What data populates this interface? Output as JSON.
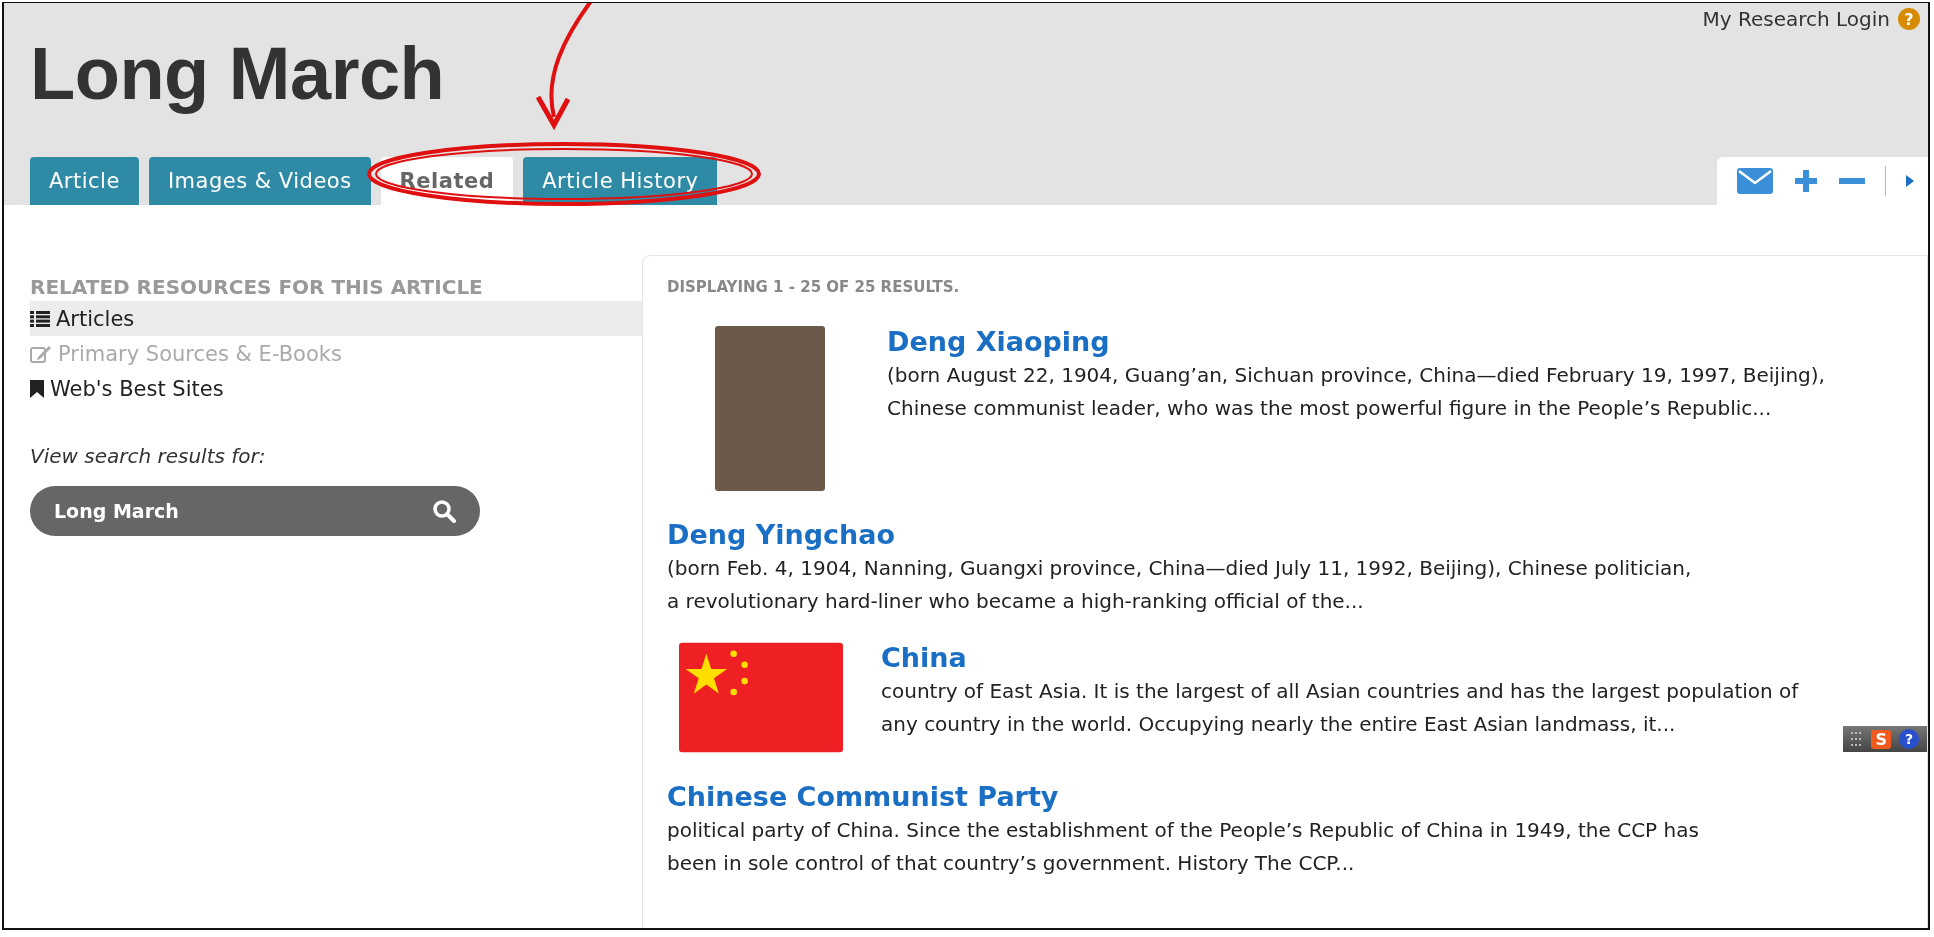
{
  "header": {
    "login_link": "My Research Login",
    "help_icon": "?",
    "title": "Long March"
  },
  "tabs": [
    {
      "label": "Article",
      "selected": false
    },
    {
      "label": "Images & Videos",
      "selected": false
    },
    {
      "label": "Related",
      "selected": true
    },
    {
      "label": "Article History",
      "selected": false
    }
  ],
  "sidebar": {
    "heading": "RELATED RESOURCES FOR THIS ARTICLE",
    "items": [
      {
        "kind": "list",
        "label": "Articles",
        "selected": true,
        "disabled": false
      },
      {
        "kind": "edit",
        "label": "Primary Sources & E-Books",
        "selected": false,
        "disabled": true
      },
      {
        "kind": "bookmark",
        "label": "Web's Best Sites",
        "selected": false,
        "disabled": false
      }
    ],
    "search_label": "View search results for:",
    "search": {
      "value": "Long March"
    }
  },
  "results": {
    "summary": "DISPLAYING 1 - 25 OF 25 RESULTS.",
    "items": [
      {
        "kind": "photo",
        "title": "Deng Xiaoping",
        "snippet": "(born August 22, 1904, Guang’an, Sichuan province, China—died February 19, 1997, Beijing), Chinese communist leader, who was the most powerful figure in the People’s Republic..."
      },
      {
        "kind": "text",
        "title": "Deng Yingchao",
        "snippet": "(born Feb. 4, 1904, Nanning, Guangxi province, China—died July 11, 1992, Beijing), Chinese politician, a revolutionary hard-liner who became a high-ranking official of the..."
      },
      {
        "kind": "flag",
        "title": "China",
        "snippet": "country of East Asia. It is the largest of all Asian countries and has the largest population of any country in the world. Occupying nearly the entire East Asian landmass, it..."
      },
      {
        "kind": "text",
        "title": "Chinese Communist Party",
        "snippet": "political party of China. Since the establishment of the People’s Republic of China in 1949, the CCP has been in sole control of that country’s government. History The CCP..."
      }
    ]
  },
  "ime_toolbar": {
    "logo": "S",
    "help": "?"
  }
}
